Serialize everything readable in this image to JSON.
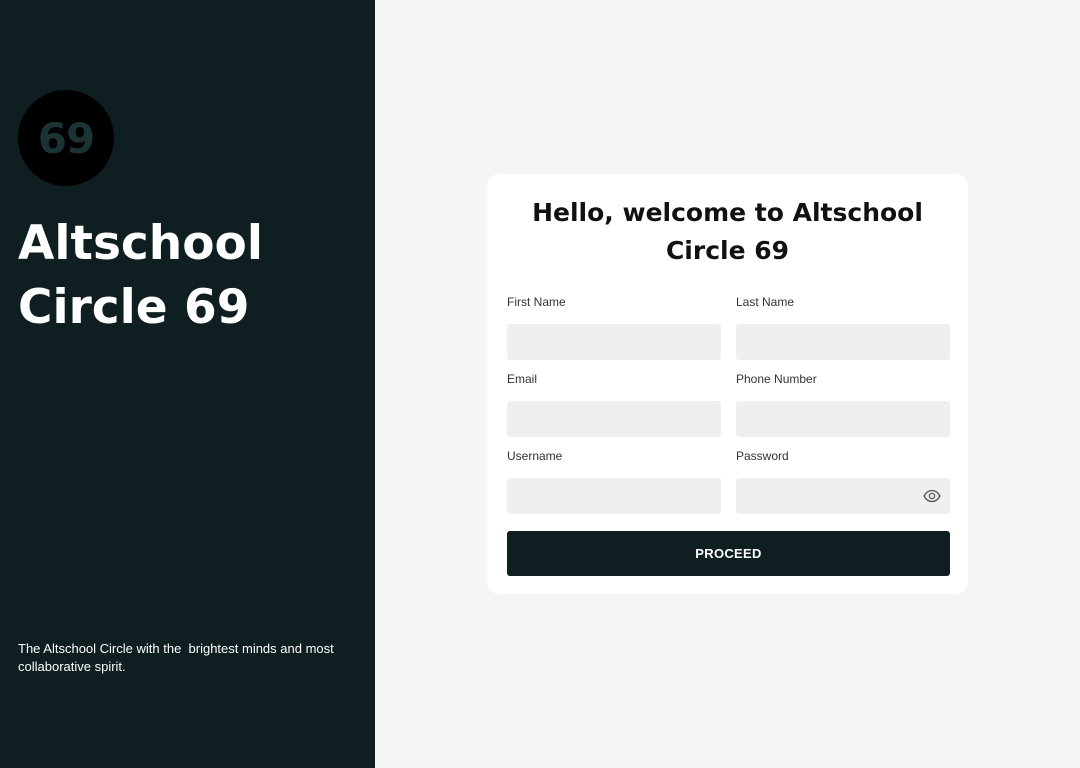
{
  "brand": {
    "logo_text": "69",
    "title_line1": "Altschool",
    "title_line2": "Circle 69",
    "tagline": "The Altschool Circle with the  brightest minds and most collaborative spirit."
  },
  "form": {
    "title_line1": "Hello, welcome to Altschool",
    "title_line2": "Circle 69",
    "fields": {
      "first_name": {
        "label": "First Name",
        "value": ""
      },
      "last_name": {
        "label": "Last Name",
        "value": ""
      },
      "email": {
        "label": "Email",
        "value": ""
      },
      "phone_number": {
        "label": "Phone Number",
        "value": ""
      },
      "username": {
        "label": "Username",
        "value": ""
      },
      "password": {
        "label": "Password",
        "value": "",
        "toggle_icon": "eye-icon"
      }
    },
    "submit_label": "PROCEED"
  },
  "colors": {
    "panel_bg": "#0e1e21",
    "page_bg": "#f5f5f5",
    "input_bg": "#efefef",
    "button_bg": "#0e1e21"
  }
}
